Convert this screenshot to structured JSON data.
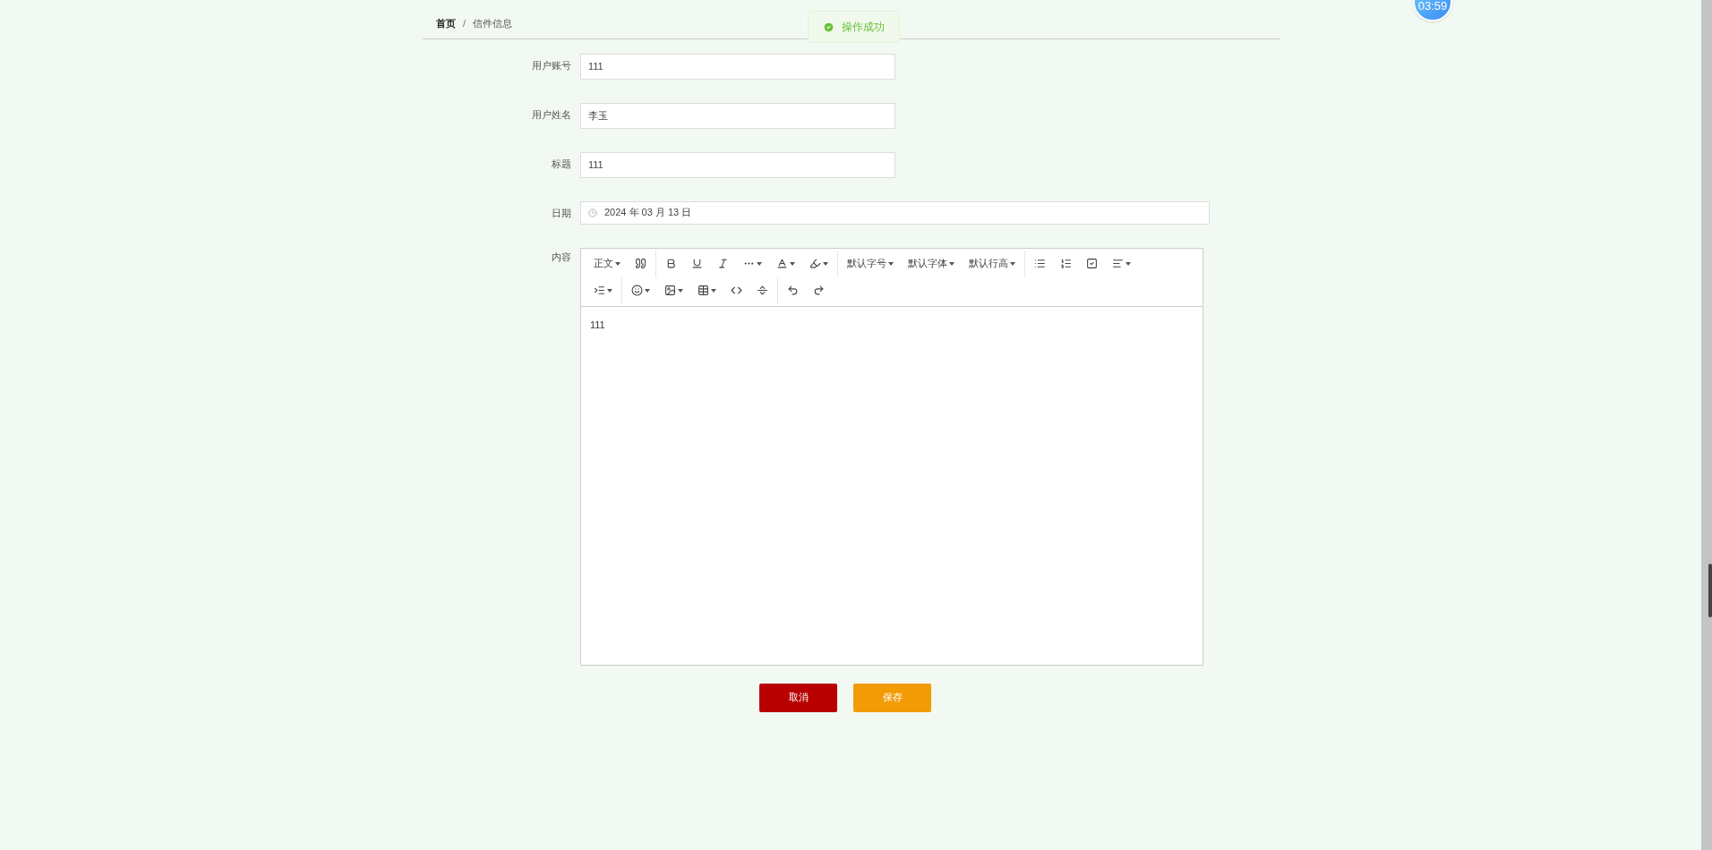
{
  "breadcrumb": [
    {
      "label": "首页",
      "current": false
    },
    {
      "label": "信件信息",
      "current": true
    }
  ],
  "breadcrumb_separator": "/",
  "toast": {
    "message": "操作成功"
  },
  "timer": "03:59",
  "fields": [
    {
      "label": "用户账号",
      "value": "111",
      "kind": "text"
    },
    {
      "label": "用户姓名",
      "value": "李玉",
      "kind": "text"
    },
    {
      "label": "标题",
      "value": "111",
      "kind": "text"
    },
    {
      "label": "日期",
      "value": "2024 年 03 月 13 日",
      "kind": "date"
    }
  ],
  "editor": {
    "label": "内容",
    "block_format": "正文",
    "font_menus": [
      "默认字号",
      "默认字体",
      "默认行高"
    ],
    "content": "111"
  },
  "buttons": [
    {
      "label": "取消",
      "kind": "cancel"
    },
    {
      "label": "保存",
      "kind": "save"
    }
  ]
}
